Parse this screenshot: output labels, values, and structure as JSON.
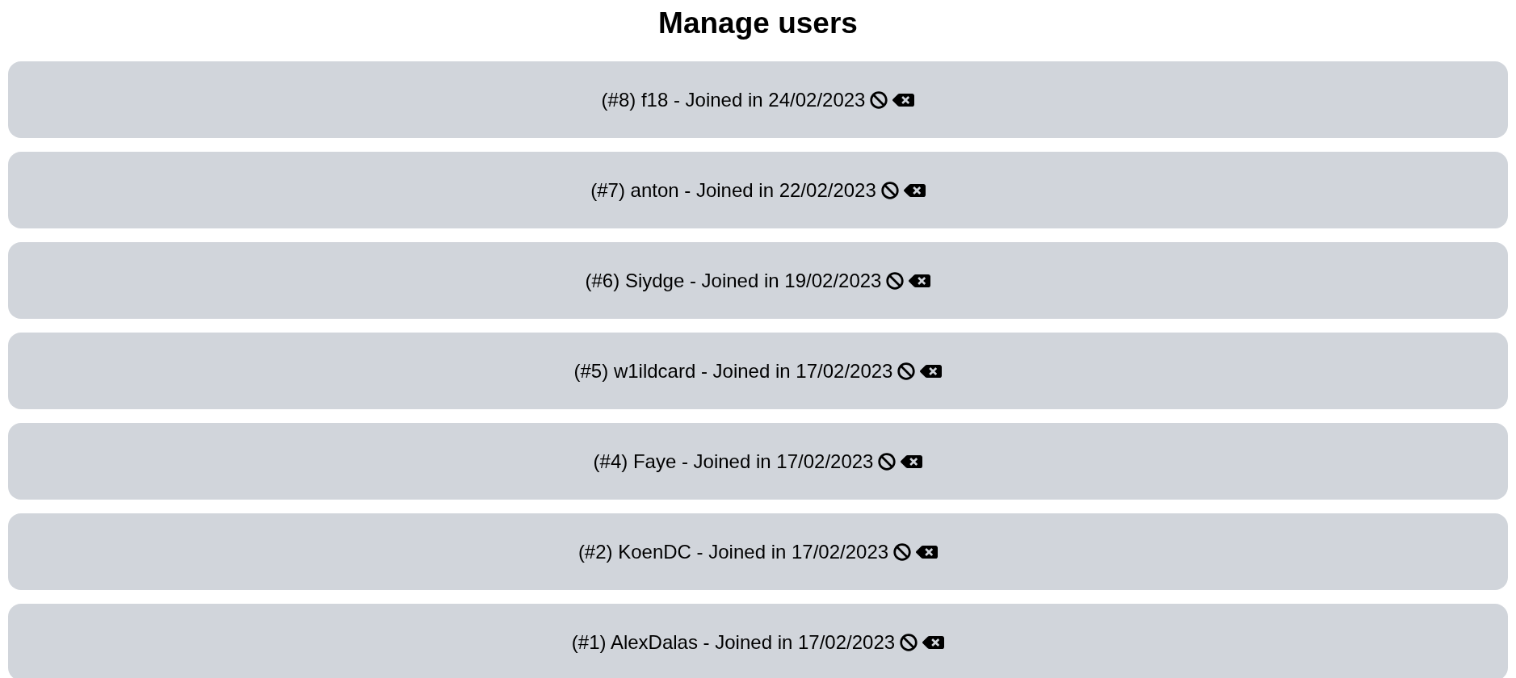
{
  "title": "Manage users",
  "users": [
    {
      "label": "(#8) f18 - Joined in 24/02/2023"
    },
    {
      "label": "(#7) anton - Joined in 22/02/2023"
    },
    {
      "label": "(#6) Siydge - Joined in 19/02/2023"
    },
    {
      "label": "(#5) w1ildcard - Joined in 17/02/2023"
    },
    {
      "label": "(#4) Faye - Joined in 17/02/2023"
    },
    {
      "label": "(#2) KoenDC - Joined in 17/02/2023"
    },
    {
      "label": "(#1) AlexDalas - Joined in 17/02/2023"
    }
  ]
}
